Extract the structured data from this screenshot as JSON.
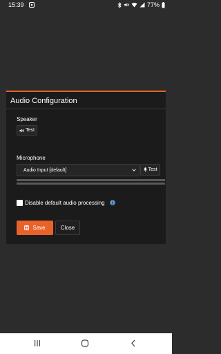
{
  "status_bar": {
    "time": "15:39",
    "battery": "77%"
  },
  "dialog": {
    "title": "Audio Configuration",
    "speaker": {
      "label": "Speaker",
      "test_button": "Test"
    },
    "microphone": {
      "label": "Microphone",
      "selected_input": "Audio Input [default]",
      "test_button": "Test"
    },
    "disable_processing": {
      "label": "Disable default audio processing",
      "checked": false
    },
    "buttons": {
      "save": "Save",
      "close": "Close"
    }
  },
  "colors": {
    "accent": "#e8622a",
    "dialog_bg": "#1b1b1b",
    "page_bg": "#2c2c2c",
    "info_icon": "#5b9bd5"
  }
}
